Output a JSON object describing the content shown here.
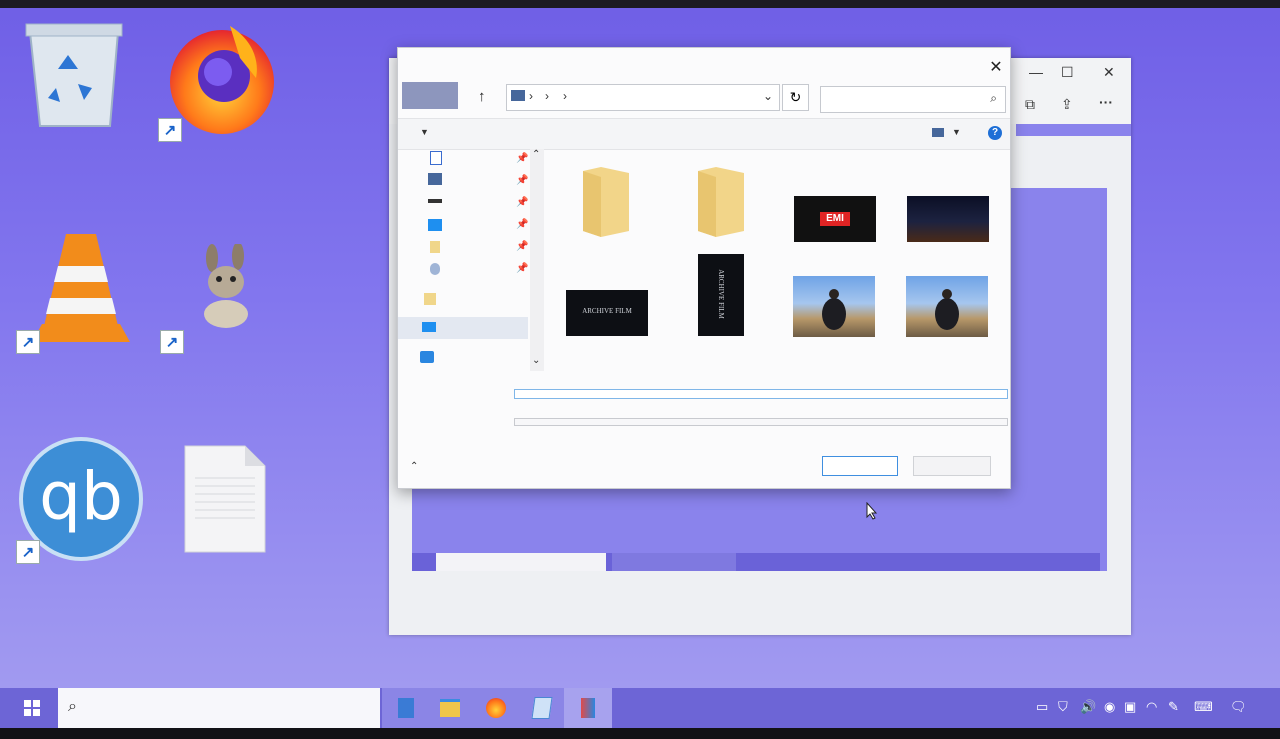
{
  "desktop": {
    "icons": [
      {
        "name": "recycle-bin"
      },
      {
        "name": "firefox"
      },
      {
        "name": "vlc"
      },
      {
        "name": "emule"
      },
      {
        "name": "qbittorrent",
        "logo_text": "qb"
      },
      {
        "name": "text-document"
      }
    ]
  },
  "dialog": {
    "close_glyph": "✕",
    "thumbnails": [
      {
        "kind": "folder"
      },
      {
        "kind": "folder"
      },
      {
        "kind": "video",
        "label": "EMI"
      },
      {
        "kind": "video"
      },
      {
        "kind": "video",
        "label": "ARCHIVE FILM"
      },
      {
        "kind": "video",
        "label": "ARCHIVE FILM"
      },
      {
        "kind": "video"
      },
      {
        "kind": "video"
      }
    ]
  },
  "colors": {
    "desktop": "#7b6fea",
    "taskbar": "#6d65d6",
    "accent": "#3f8fe0"
  }
}
